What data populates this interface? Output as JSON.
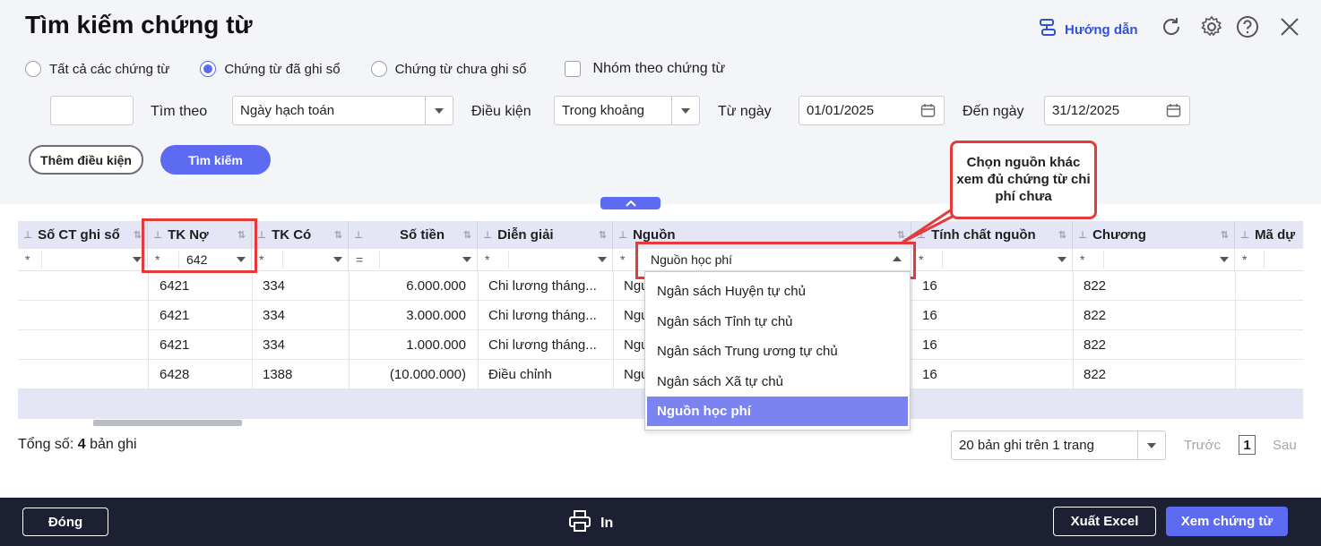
{
  "header": {
    "title": "Tìm kiếm chứng từ",
    "help_label": "Hướng dẫn"
  },
  "filters": {
    "radio_options": [
      "Tất cả các chứng từ",
      "Chứng từ đã ghi sổ",
      "Chứng từ chưa ghi sổ"
    ],
    "selected_radio": "Chứng từ đã ghi sổ",
    "group_checkbox_label": "Nhóm theo chứng từ",
    "group_checked": false,
    "search_by_label": "Tìm theo",
    "search_by_value": "Ngày hạch toán",
    "condition_label": "Điều kiện",
    "condition_value": "Trong khoảng",
    "from_label": "Từ ngày",
    "from_value": "01/01/2025",
    "to_label": "Đến ngày",
    "to_value": "31/12/2025",
    "add_condition_label": "Thêm điều kiện",
    "search_button_label": "Tìm kiếm"
  },
  "table": {
    "columns": [
      "Số CT ghi sổ",
      "TK Nợ",
      "TK Có",
      "Số tiền",
      "Diễn giải",
      "Nguồn",
      "Tính chất nguồn",
      "Chương",
      "Mã dự"
    ],
    "filters": {
      "star": "*",
      "equals": "=",
      "tk_no": "642",
      "nguon": "Nguồn học phí"
    },
    "rows": [
      {
        "so_ct": "",
        "tk_no": "6421",
        "tk_co": "334",
        "so_tien": "6.000.000",
        "dien_giai": "Chi lương tháng...",
        "nguon": "Ngu",
        "tinh_chat": "16",
        "chuong": "822"
      },
      {
        "so_ct": "",
        "tk_no": "6421",
        "tk_co": "334",
        "so_tien": "3.000.000",
        "dien_giai": "Chi lương tháng...",
        "nguon": "Ngu",
        "tinh_chat": "16",
        "chuong": "822"
      },
      {
        "so_ct": "",
        "tk_no": "6421",
        "tk_co": "334",
        "so_tien": "1.000.000",
        "dien_giai": "Chi lương tháng...",
        "nguon": "Ngu",
        "tinh_chat": "16",
        "chuong": "822"
      },
      {
        "so_ct": "",
        "tk_no": "6428",
        "tk_co": "1388",
        "so_tien": "(10.000.000)",
        "dien_giai": "Điều chỉnh",
        "nguon": "Ngu",
        "tinh_chat": "16",
        "chuong": "822"
      }
    ]
  },
  "dropdown": {
    "items": [
      "Ngân sách Huyện tự chủ",
      "Ngân sách Tỉnh tự chủ",
      "Ngân sách Trung ương tự chủ",
      "Ngân sách Xã tự chủ",
      "Nguồn học phí"
    ],
    "selected": "Nguồn học phí"
  },
  "callout": {
    "text": "Chọn nguồn khác xem đủ chứng từ chi phí chưa"
  },
  "footer": {
    "total_label": "Tổng số:",
    "total_count": "4",
    "total_suffix": "bản ghi",
    "page_size_label": "20 bản ghi trên 1 trang",
    "prev_label": "Trước",
    "page_number": "1",
    "next_label": "Sau"
  },
  "bottom": {
    "close_label": "Đóng",
    "print_label": "In",
    "export_label": "Xuất Excel",
    "view_label": "Xem chứng từ"
  },
  "colors": {
    "accent": "#5c6bf2",
    "highlight_border": "#e53a3a",
    "bottom_bar": "#1d2033"
  }
}
